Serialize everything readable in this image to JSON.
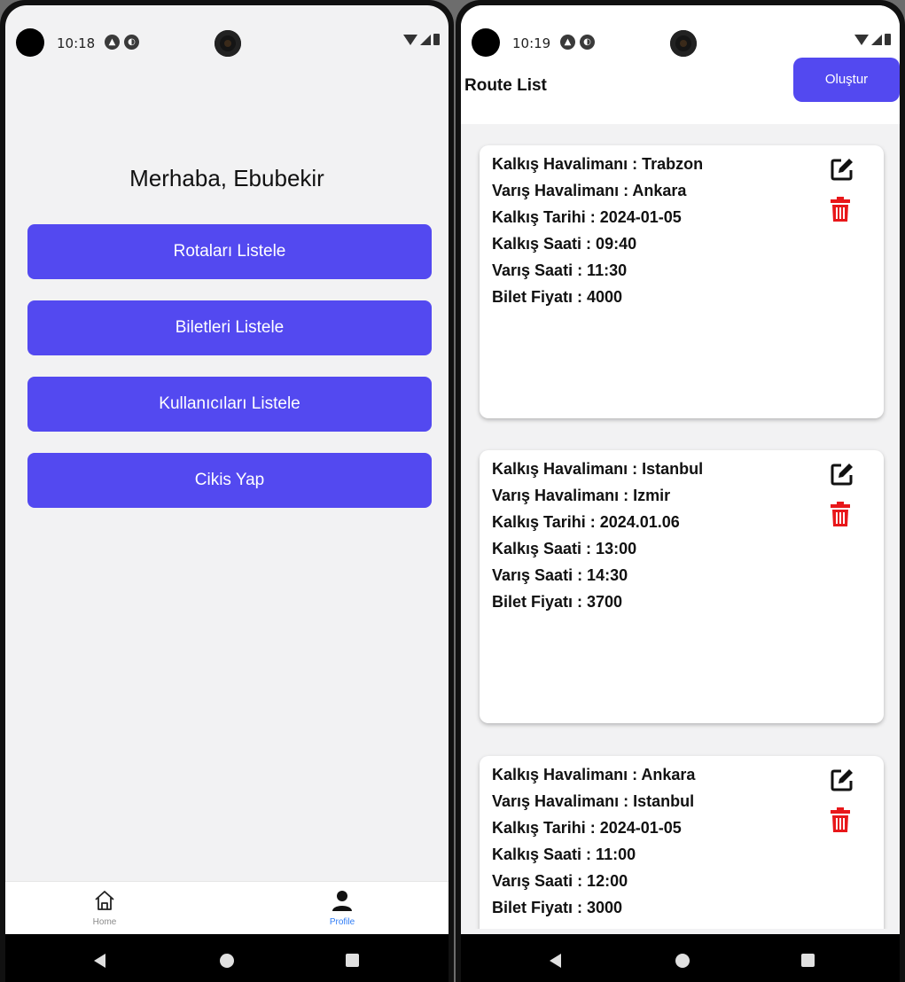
{
  "left": {
    "status": {
      "time": "10:18"
    },
    "greeting": "Merhaba, Ebubekir",
    "menu_buttons": [
      {
        "label": "Rotaları Listele"
      },
      {
        "label": "Biletleri Listele"
      },
      {
        "label": "Kullanıcıları Listele"
      },
      {
        "label": "Cikis Yap"
      }
    ],
    "tabs": [
      {
        "label": "Home",
        "icon": "home-icon",
        "active": false
      },
      {
        "label": "Profile",
        "icon": "person-icon",
        "active": true
      }
    ]
  },
  "right": {
    "status": {
      "time": "10:19"
    },
    "header": {
      "title": "Route List",
      "create_label": "Oluştur"
    },
    "routes": [
      {
        "departure_airport": "Kalkış Havalimanı : Trabzon",
        "arrival_airport": "Varış Havalimanı : Ankara",
        "departure_date": "Kalkış Tarihi : 2024-01-05",
        "departure_time": "Kalkış Saati : 09:40",
        "arrival_time": "Varış Saati : 11:30",
        "price": "Bilet Fiyatı : 4000"
      },
      {
        "departure_airport": "Kalkış Havalimanı : Istanbul",
        "arrival_airport": "Varış Havalimanı : Izmir",
        "departure_date": "Kalkış Tarihi : 2024.01.06",
        "departure_time": "Kalkış Saati : 13:00",
        "arrival_time": "Varış Saati : 14:30",
        "price": "Bilet Fiyatı : 3700"
      },
      {
        "departure_airport": "Kalkış Havalimanı : Ankara",
        "arrival_airport": "Varış Havalimanı : Istanbul",
        "departure_date": "Kalkış Tarihi : 2024-01-05",
        "departure_time": "Kalkış Saati : 11:00",
        "arrival_time": "Varış Saati : 12:00",
        "price": "Bilet Fiyatı : 3000"
      }
    ]
  },
  "colors": {
    "accent": "#5349f0",
    "delete": "#e8171a",
    "active_tab": "#2f7cf6",
    "background": "#f2f2f3"
  }
}
